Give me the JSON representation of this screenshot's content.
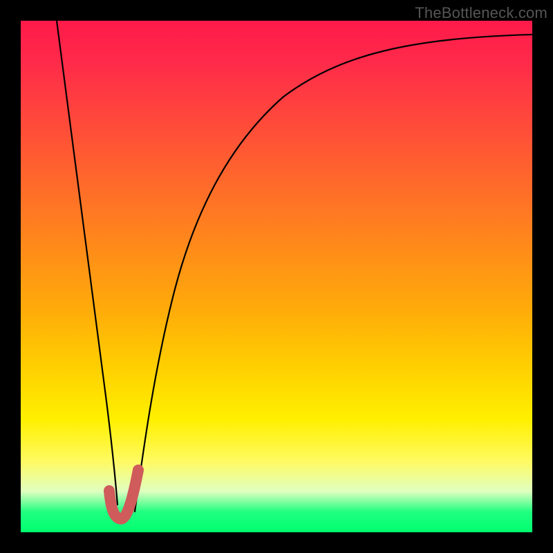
{
  "watermark": "TheBottleneck.com",
  "chart_data": {
    "type": "line",
    "title": "",
    "xlabel": "",
    "ylabel": "",
    "xlim": [
      0,
      100
    ],
    "ylim": [
      0,
      100
    ],
    "background": "red-yellow-green vertical gradient (bottleneck %)",
    "series": [
      {
        "name": "left-falling-curve",
        "color": "#000000",
        "x": [
          7,
          8,
          10,
          12,
          14,
          16,
          17.5,
          18.5
        ],
        "values": [
          100,
          90,
          74,
          58,
          42,
          26,
          12,
          4
        ]
      },
      {
        "name": "right-rising-curve",
        "color": "#000000",
        "x": [
          22,
          24,
          27,
          31,
          36,
          42,
          50,
          60,
          72,
          86,
          100
        ],
        "values": [
          4,
          18,
          36,
          52,
          64,
          74,
          82,
          88,
          92,
          94.5,
          96
        ]
      },
      {
        "name": "valley-tick",
        "color": "#d05858",
        "stroke_width": 12,
        "x_norm": [
          17,
          18,
          19,
          20,
          22,
          23
        ],
        "y_norm": [
          8,
          3,
          2,
          2,
          7,
          12
        ]
      }
    ],
    "optimal_x": 20
  }
}
